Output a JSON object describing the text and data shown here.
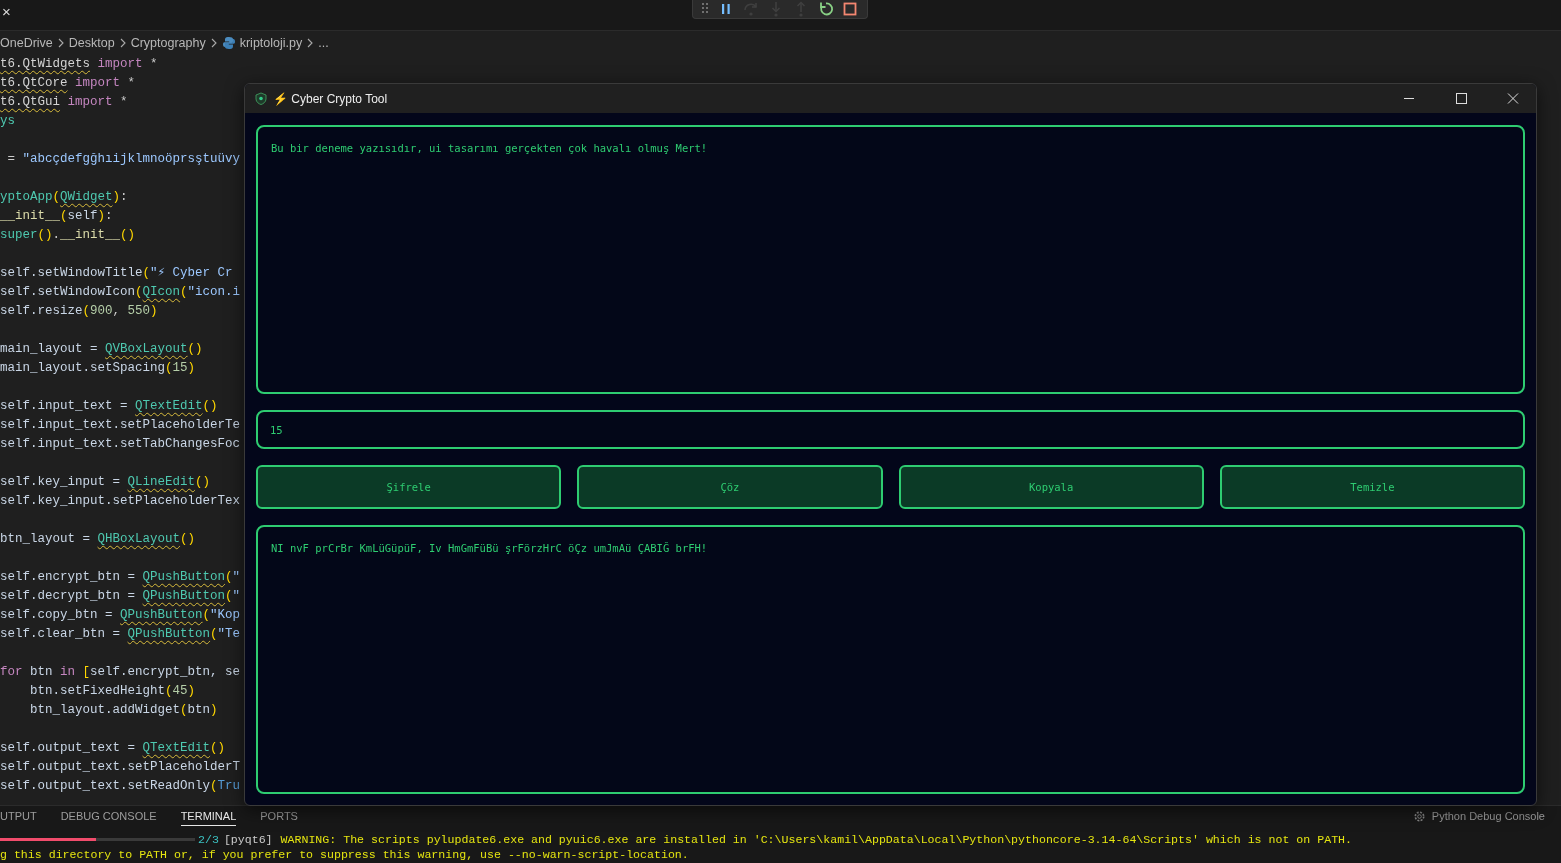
{
  "editor_tab": {
    "close": "×"
  },
  "debug_toolbar": [
    {
      "kind": "grip",
      "disabled": false
    },
    {
      "kind": "pause",
      "disabled": false
    },
    {
      "kind": "step-over",
      "disabled": true
    },
    {
      "kind": "step-into",
      "disabled": true
    },
    {
      "kind": "step-out",
      "disabled": true
    },
    {
      "kind": "restart",
      "disabled": false
    },
    {
      "kind": "stop",
      "disabled": false
    }
  ],
  "breadcrumb": [
    {
      "label": "OneDrive",
      "kind": "folder"
    },
    {
      "label": "Desktop",
      "kind": "folder"
    },
    {
      "label": "Cryptography",
      "kind": "folder"
    },
    {
      "label": "kriptoloji.py",
      "kind": "file"
    },
    {
      "label": "...",
      "kind": "more"
    }
  ],
  "code": [
    [
      [
        {
          "text": "t6.QtWidgets",
          "kind": "module"
        },
        {
          "text": " import",
          "kind": "keyword"
        },
        {
          "text": " *",
          "kind": "plain"
        }
      ],
      [
        {
          "text": "t6.QtCore",
          "kind": "module"
        },
        {
          "text": " import",
          "kind": "keyword"
        },
        {
          "text": " *",
          "kind": "plain"
        }
      ],
      [
        {
          "text": "t6.QtGui",
          "kind": "module"
        },
        {
          "text": " import",
          "kind": "keyword"
        },
        {
          "text": " *",
          "kind": "plain"
        }
      ],
      [
        {
          "text": "ys",
          "kind": "builtin"
        }
      ]
    ],
    [
      [
        {
          "text": " = ",
          "kind": "plain"
        },
        {
          "text": "\"abcçdefgğhıijklmnoöprsştuüvy",
          "kind": "string"
        }
      ]
    ],
    [
      [
        {
          "text": "yptoApp",
          "kind": "builtin"
        },
        {
          "text": "(",
          "kind": "bracket"
        },
        {
          "text": "QWidget",
          "kind": "type"
        },
        {
          "text": ")",
          "kind": "bracket"
        },
        {
          "text": ":",
          "kind": "plain"
        }
      ],
      [
        {
          "text": "__init__",
          "kind": "func"
        },
        {
          "text": "(",
          "kind": "bracket"
        },
        {
          "text": "self",
          "kind": "name"
        },
        {
          "text": ")",
          "kind": "bracket"
        },
        {
          "text": ":",
          "kind": "plain"
        }
      ],
      [
        {
          "text": "super",
          "kind": "builtin"
        },
        {
          "text": "()",
          "kind": "bracket"
        },
        {
          "text": ".",
          "kind": "plain"
        },
        {
          "text": "__init__",
          "kind": "func"
        },
        {
          "text": "()",
          "kind": "bracket"
        }
      ]
    ],
    [
      [
        {
          "text": "self.setWindowTitle",
          "kind": "name"
        },
        {
          "text": "(",
          "kind": "bracket"
        },
        {
          "text": "\"⚡ Cyber Cr",
          "kind": "string"
        }
      ],
      [
        {
          "text": "self.setWindowIcon",
          "kind": "name"
        },
        {
          "text": "(",
          "kind": "bracket"
        },
        {
          "text": "QIcon",
          "kind": "type"
        },
        {
          "text": "(",
          "kind": "bracket"
        },
        {
          "text": "\"icon.i",
          "kind": "string"
        }
      ],
      [
        {
          "text": "self.resize",
          "kind": "name"
        },
        {
          "text": "(",
          "kind": "bracket"
        },
        {
          "text": "900",
          "kind": "number"
        },
        {
          "text": ", ",
          "kind": "plain"
        },
        {
          "text": "550",
          "kind": "number"
        },
        {
          "text": ")",
          "kind": "bracket"
        }
      ]
    ],
    [
      [
        {
          "text": "main_layout = ",
          "kind": "name"
        },
        {
          "text": "QVBoxLayout",
          "kind": "type"
        },
        {
          "text": "()",
          "kind": "bracket"
        }
      ],
      [
        {
          "text": "main_layout.setSpacing",
          "kind": "name"
        },
        {
          "text": "(",
          "kind": "bracket"
        },
        {
          "text": "15",
          "kind": "number"
        },
        {
          "text": ")",
          "kind": "bracket"
        }
      ]
    ],
    [
      [
        {
          "text": "self.input_text = ",
          "kind": "name"
        },
        {
          "text": "QTextEdit",
          "kind": "type"
        },
        {
          "text": "()",
          "kind": "bracket"
        }
      ],
      [
        {
          "text": "self.input_text.setPlaceholderTe",
          "kind": "name"
        }
      ],
      [
        {
          "text": "self.input_text.setTabChangesFoc",
          "kind": "name"
        }
      ]
    ],
    [
      [
        {
          "text": "self.key_input = ",
          "kind": "name"
        },
        {
          "text": "QLineEdit",
          "kind": "type"
        },
        {
          "text": "()",
          "kind": "bracket"
        }
      ],
      [
        {
          "text": "self.key_input.setPlaceholderTex",
          "kind": "name"
        }
      ]
    ],
    [
      [
        {
          "text": "btn_layout = ",
          "kind": "name"
        },
        {
          "text": "QHBoxLayout",
          "kind": "type"
        },
        {
          "text": "()",
          "kind": "bracket"
        }
      ]
    ],
    [
      [
        {
          "text": "self.encrypt_btn = ",
          "kind": "name"
        },
        {
          "text": "QPushButton",
          "kind": "type"
        },
        {
          "text": "(",
          "kind": "bracket"
        },
        {
          "text": "\"",
          "kind": "string"
        }
      ],
      [
        {
          "text": "self.decrypt_btn = ",
          "kind": "name"
        },
        {
          "text": "QPushButton",
          "kind": "type"
        },
        {
          "text": "(",
          "kind": "bracket"
        },
        {
          "text": "\"",
          "kind": "string"
        }
      ],
      [
        {
          "text": "self.copy_btn = ",
          "kind": "name"
        },
        {
          "text": "QPushButton",
          "kind": "type"
        },
        {
          "text": "(",
          "kind": "bracket"
        },
        {
          "text": "\"Kop",
          "kind": "string"
        }
      ],
      [
        {
          "text": "self.clear_btn = ",
          "kind": "name"
        },
        {
          "text": "QPushButton",
          "kind": "type"
        },
        {
          "text": "(",
          "kind": "bracket"
        },
        {
          "text": "\"Te",
          "kind": "string"
        }
      ]
    ],
    [
      [
        {
          "text": "for",
          "kind": "keyword"
        },
        {
          "text": " btn ",
          "kind": "name"
        },
        {
          "text": "in ",
          "kind": "keyword"
        },
        {
          "text": "[",
          "kind": "bracket"
        },
        {
          "text": "self.encrypt_btn, se",
          "kind": "name"
        }
      ],
      [
        {
          "text": "    btn.setFixedHeight",
          "kind": "name"
        },
        {
          "text": "(",
          "kind": "bracket"
        },
        {
          "text": "45",
          "kind": "number"
        },
        {
          "text": ")",
          "kind": "bracket"
        }
      ],
      [
        {
          "text": "    btn_layout.addWidget",
          "kind": "name"
        },
        {
          "text": "(",
          "kind": "bracket"
        },
        {
          "text": "btn",
          "kind": "name"
        },
        {
          "text": ")",
          "kind": "bracket"
        }
      ]
    ],
    [
      [
        {
          "text": "self.output_text = ",
          "kind": "name"
        },
        {
          "text": "QTextEdit",
          "kind": "type"
        },
        {
          "text": "()",
          "kind": "bracket"
        }
      ],
      [
        {
          "text": "self.output_text.setPlaceholderT",
          "kind": "name"
        }
      ],
      [
        {
          "text": "self.output_text.setReadOnly",
          "kind": "name"
        },
        {
          "text": "(",
          "kind": "bracket"
        },
        {
          "text": "Tru",
          "kind": "constant"
        }
      ]
    ]
  ],
  "panel": {
    "tabs": [
      {
        "label": "UTPUT",
        "selected": false
      },
      {
        "label": "DEBUG CONSOLE",
        "selected": false
      },
      {
        "label": "TERMINAL",
        "selected": true
      },
      {
        "label": "PORTS",
        "selected": false
      }
    ],
    "console_label": "Python Debug Console",
    "terminal": {
      "progress": {
        "level": 0.49
      },
      "step": "2/3",
      "env": "[pyqt6]",
      "lines": [
        "WARNING: The scripts pylupdate6.exe and pyuic6.exe are installed in 'C:\\Users\\kamil\\AppData\\Local\\Python\\pythoncore-3.14-64\\Scripts' which is not on PATH.",
        "g this directory to PATH or, if you prefer to suppress this warning, use --no-warn-script-location."
      ]
    }
  },
  "app_window": {
    "title": "⚡ Cyber Crypto Tool",
    "input_text": "Bu bir deneme yazısıdır, ui tasarımı gerçekten çok havalı olmuş Mert!",
    "key_input": "15",
    "buttons": [
      "Şifrele",
      "Çöz",
      "Kopyala",
      "Temizle"
    ],
    "output_text": "NI nvF prCrBr KmLüGüpüF, Iv HmGmFüBü şrFörzHrC öÇz umJmAü ÇABIĞ brFH!"
  }
}
